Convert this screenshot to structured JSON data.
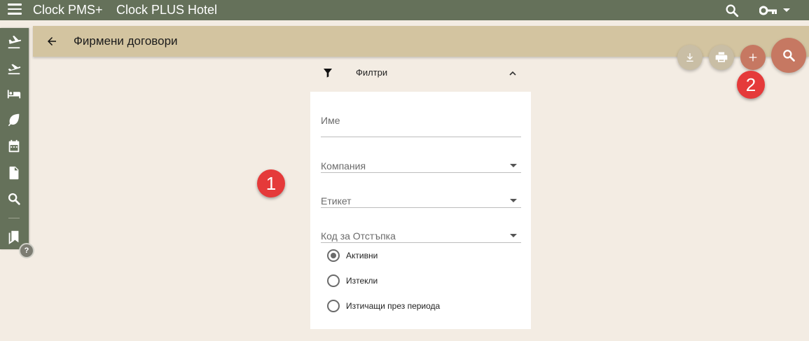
{
  "app": {
    "name": "Clock PMS+",
    "hotel": "Clock PLUS Hotel"
  },
  "topbar": {
    "menu_icon": "hamburger-menu-icon",
    "search_icon": "search-icon",
    "key_icon": "key-icon",
    "caret_icon": "caret-down-icon",
    "color": "#65715a"
  },
  "sidebar": {
    "items": [
      {
        "icon": "flight-land-icon"
      },
      {
        "icon": "flight-takeoff-icon"
      },
      {
        "icon": "hotel-bed-icon"
      },
      {
        "icon": "leaf-icon"
      },
      {
        "icon": "calendar-icon"
      },
      {
        "icon": "document-icon"
      },
      {
        "icon": "search-icon"
      },
      {
        "icon": "bookmarks-icon"
      }
    ],
    "help_label": "?"
  },
  "page": {
    "title": "Фирмени договори",
    "back_icon": "arrow-back-icon",
    "title_bar_color": "#d3c4a0"
  },
  "actions": {
    "download_icon": "download-icon",
    "print_icon": "print-icon",
    "add_icon": "plus-icon",
    "search_icon": "search-icon",
    "accent": "#c67862"
  },
  "markers": {
    "one": "1",
    "two": "2",
    "color": "#e53a3a"
  },
  "filters": {
    "title": "Филтри",
    "filter_icon": "filter-funnel-icon",
    "collapse_icon": "chevron-up-icon",
    "fields": {
      "name": {
        "label": "Име",
        "value": ""
      },
      "company": {
        "label": "Компания",
        "value": ""
      },
      "tag": {
        "label": "Етикет",
        "value": ""
      },
      "discount_code": {
        "label": "Код за Отстъпка",
        "value": ""
      }
    },
    "status_options": [
      {
        "label": "Активни",
        "selected": true
      },
      {
        "label": "Изтекли",
        "selected": false
      },
      {
        "label": "Изтичащи през периода",
        "selected": false
      }
    ]
  }
}
